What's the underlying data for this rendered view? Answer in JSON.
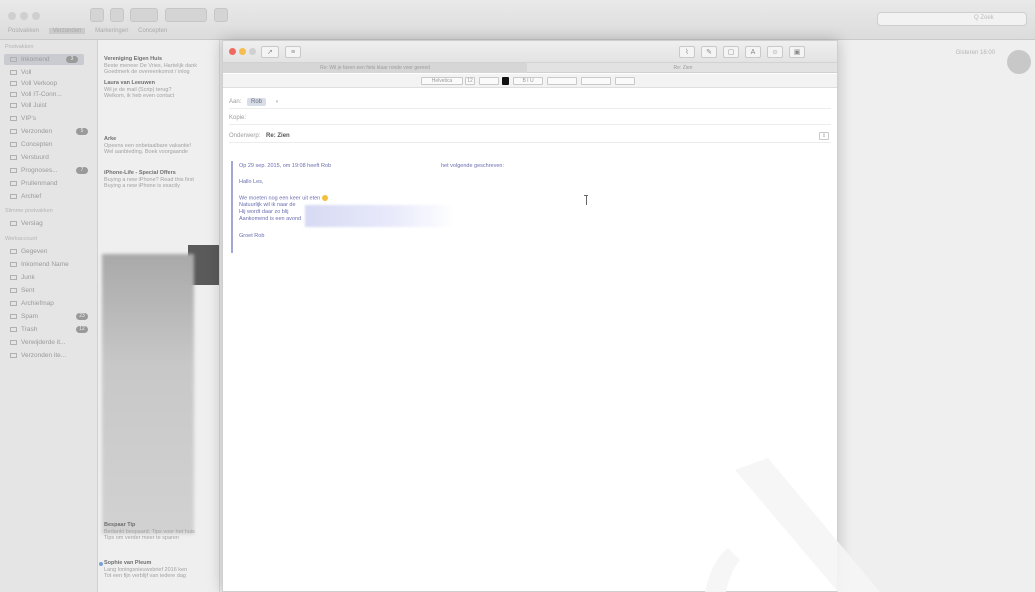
{
  "background_window": {
    "search_placeholder": "Q Zoek",
    "favorites": [
      "Postvakken",
      "Verzonden",
      "Markeringen",
      "Concepten"
    ],
    "sidebar": {
      "section_postvakken": "Postvakken",
      "section_shared": "Slimme postvakken",
      "section_account": "Werkaccount",
      "items": [
        {
          "label": "Inkomend",
          "count": "3"
        },
        {
          "label": "Voll"
        },
        {
          "label": "Voll Verkoop"
        },
        {
          "label": "Voll IT-Conn..."
        },
        {
          "label": "Voll Juist"
        },
        {
          "label": "VIP's"
        },
        {
          "label": "Verzonden",
          "count": "5"
        },
        {
          "label": "Concepten"
        },
        {
          "label": "Verstuurd"
        },
        {
          "label": "Prognoses...",
          "count": "7"
        },
        {
          "label": "Prullenmand"
        },
        {
          "label": "Archief"
        },
        {
          "label": "Verslag"
        },
        {
          "label": "Gegeven"
        },
        {
          "label": "Inkomend Name"
        },
        {
          "label": "Junk"
        },
        {
          "label": "Sent"
        },
        {
          "label": "Archiefmap"
        },
        {
          "label": "Spam",
          "count": "23"
        },
        {
          "label": "Trash",
          "count": "12"
        },
        {
          "label": "Verwijderde it..."
        },
        {
          "label": "Verzonden ite..."
        }
      ]
    },
    "messages": [
      {
        "from": "Vereniging Eigen Huis",
        "line1": "Beste meneer De Vries, Hartelijk dank",
        "line2": "Goedmerk de overeenkomst / inlog"
      },
      {
        "from": "Laura van Leeuwen",
        "line1": "Wil je de mail (Scrip) terug?",
        "line2": "Welkom, ik heb even contact"
      },
      {
        "from": "Arke",
        "line1": "Opeens een onbetaalbare vakantie!",
        "line2": "Wel aanbieding. Boek voorgaande"
      },
      {
        "from": "iPhone-Life - Special Offers",
        "line1": "Buying a new iPhone? Read this first",
        "line2": "Buying a new iPhone is exactly"
      },
      {
        "from": "Bespaar Tip",
        "line1": "Bedankt bespaard. Tips voor het huis",
        "line2": "Tips om verder meer te sparen"
      },
      {
        "from": "Sophie van Pleum",
        "line1": "Lang loningsnieuwsbrief 2016 ken",
        "line2": "Tot een fijn verblijf van iedere dag"
      }
    ],
    "right_date": "Gisteren 16:00"
  },
  "compose": {
    "title_tabs": {
      "reply": "Re: Wil je faxen een fiets klaar ronde voor gereed",
      "draft": "Re: Zien"
    },
    "format_bar": {
      "font": "Helvetica",
      "size": "12"
    },
    "header": {
      "to_label": "Aan:",
      "to_value": "Rob",
      "cc_label": "Kopie:",
      "subject_label": "Onderwerp:",
      "subject_value": "Re: Zien"
    },
    "quote": {
      "attribution": "Op 29 sep. 2015, om 19:08 heeft Rob",
      "attribution_suffix": "het volgende geschreven:",
      "greeting": "Hallo Les,",
      "line1": "We moeten nog een keer uit eten",
      "line2": "Natuurlijk wil ik naar de",
      "line3": "Hij wordt daar zo blij",
      "line4": "Aankomend is een avond",
      "signoff": "Groet Rob"
    }
  },
  "colors": {
    "quote_bar": "#a2a7d6",
    "quote_text": "#6a6fb0",
    "close": "#f0695f",
    "minimize": "#f5bd4f",
    "maximize": "#d0d0d0"
  }
}
